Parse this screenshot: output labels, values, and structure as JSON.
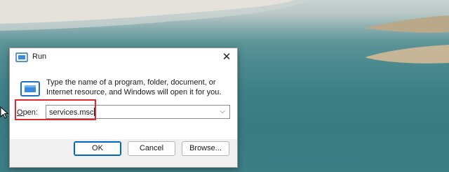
{
  "window": {
    "title": "Run",
    "close_glyph": "✕"
  },
  "dialog": {
    "description": "Type the name of a program, folder, document, or Internet resource, and Windows will open it for you.",
    "open_label_accel": "O",
    "open_label_rest": "pen:",
    "input_value": "services.msc",
    "dropdown_glyph": "⌵"
  },
  "buttons": {
    "ok": "OK",
    "cancel": "Cancel",
    "browse": "Browse..."
  },
  "icons": {
    "title": "run-icon",
    "content": "run-icon",
    "close": "close-icon",
    "dropdown": "chevron-down-icon",
    "cursor": "mouse-pointer-icon"
  },
  "colors": {
    "highlight": "#e0282e",
    "accent": "#0067c0"
  }
}
